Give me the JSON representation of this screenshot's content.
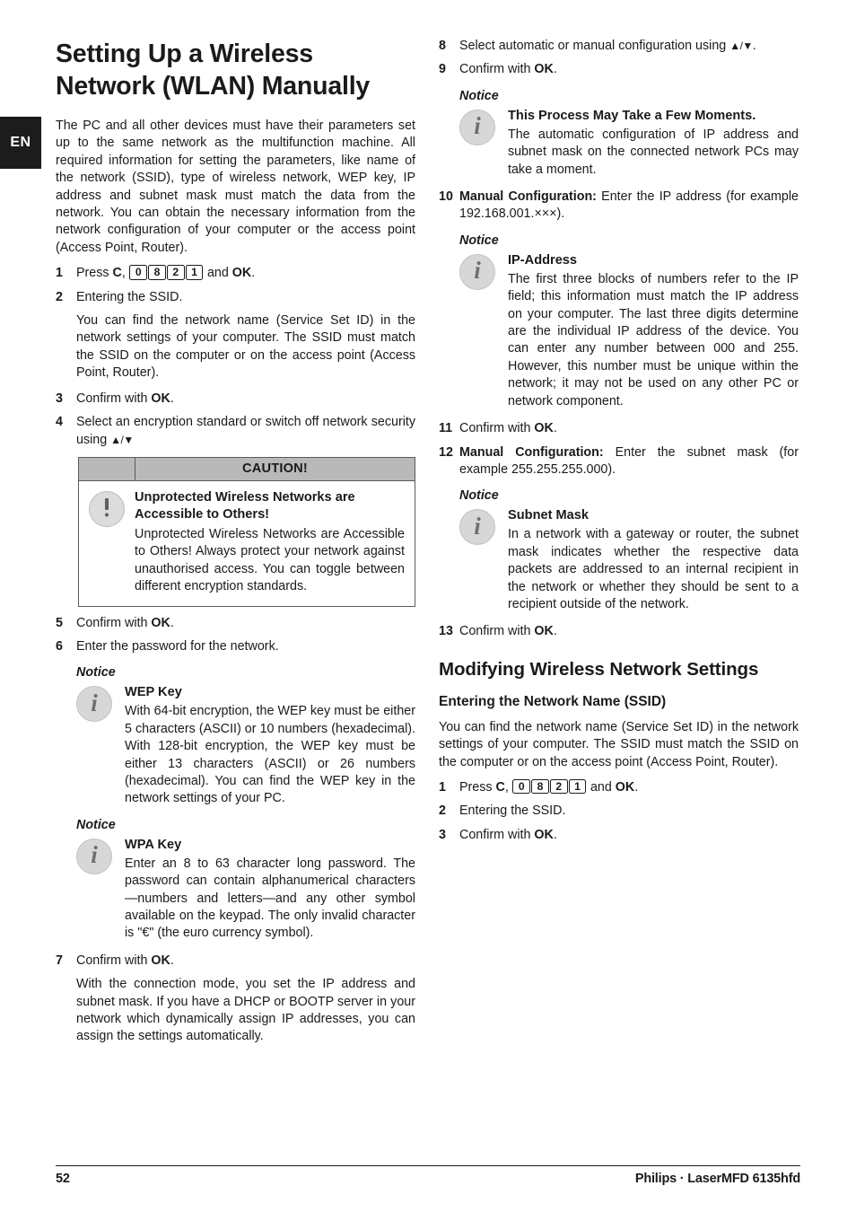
{
  "language_tab": "EN",
  "left_column": {
    "title": "Setting Up a Wireless Network (WLAN) Manually",
    "intro": "The PC and all other devices must have their parameters set up to the same network as the multifunction machine. All required information for setting the parameters, like name of the network (SSID), type of wireless network, WEP key, IP address and subnet mask must match the data from the network. You can obtain the necessary information from the network configuration of your computer or the access point (Access Point, Router).",
    "step1": {
      "num": "1",
      "press_word": "Press",
      "key_c": "C",
      "comma": ",",
      "keys": [
        "0",
        "8",
        "2",
        "1"
      ],
      "and_word": "and",
      "key_ok": "OK",
      "period": "."
    },
    "step2": {
      "num": "2",
      "text": "Entering the SSID."
    },
    "step2_cont": "You can find the network name (Service Set ID) in the network settings of your computer. The SSID must match the SSID on the computer or on the access point (Access Point, Router).",
    "step3": {
      "num": "3",
      "prefix": "Confirm with ",
      "key_ok": "OK",
      "suffix": "."
    },
    "step4": {
      "num": "4",
      "text": "Select an encryption standard or switch off network security using ",
      "arrows": "▲/▼"
    },
    "caution": {
      "header": "CAUTION!",
      "icon": "exclamation-icon",
      "heading": "Unprotected Wireless Networks are Accessible to Others!",
      "text": "Unprotected Wireless Networks are Accessible to Others! Always protect your network against unauthorised access. You can toggle between different encryption standards."
    },
    "step5": {
      "num": "5",
      "prefix": "Confirm with ",
      "key_ok": "OK",
      "suffix": "."
    },
    "step6": {
      "num": "6",
      "text": "Enter the password for the network."
    },
    "notice_wep": {
      "label": "Notice",
      "icon": "info-icon",
      "heading": "WEP Key",
      "text": "With 64-bit encryption, the WEP key must be either 5 characters (ASCII) or 10 numbers (hexadecimal). With 128-bit encryption, the WEP key must be either 13 characters (ASCII) or 26 numbers (hexadecimal). You can find the WEP key in the network settings of your PC."
    },
    "notice_wpa": {
      "label": "Notice",
      "icon": "info-icon",
      "heading": "WPA Key",
      "text": "Enter an 8 to 63 character long password. The password can contain alphanumerical characters—numbers and letters—and any other symbol available on the keypad. The only invalid character is \"€\" (the euro currency symbol)."
    },
    "step7": {
      "num": "7",
      "prefix": "Confirm with ",
      "key_ok": "OK",
      "suffix": "."
    },
    "step7_cont": "With the connection mode, you set the IP address and subnet mask. If you have a DHCP or BOOTP server in your network which dynamically assign IP addresses, you can assign the settings automatically."
  },
  "right_column": {
    "step8": {
      "num": "8",
      "text": "Select automatic or manual configuration using ",
      "arrows": "▲/▼",
      "suffix": "."
    },
    "step9": {
      "num": "9",
      "prefix": "Confirm with ",
      "key_ok": "OK",
      "suffix": "."
    },
    "notice_process": {
      "label": "Notice",
      "icon": "info-icon",
      "heading": "This Process May Take a Few Moments.",
      "text": "The automatic configuration of IP address and subnet mask on the connected network PCs may take a moment."
    },
    "step10": {
      "num": "10",
      "bold_label": "Manual Configuration:",
      "text": " Enter the IP address (for example 192.168.001.×××)."
    },
    "notice_ip": {
      "label": "Notice",
      "icon": "info-icon",
      "heading": "IP-Address",
      "text": "The first three blocks of numbers refer to the IP field; this information must match the IP address on your computer. The last three digits determine are the individual IP address of the device. You can enter any number between 000 and 255. However, this number must be unique within the network; it may not be used on any other PC or network component."
    },
    "step11": {
      "num": "11",
      "prefix": "Confirm with ",
      "key_ok": "OK",
      "suffix": "."
    },
    "step12": {
      "num": "12",
      "bold_label": "Manual Configuration:",
      "text": " Enter the subnet mask (for example 255.255.255.000)."
    },
    "notice_subnet": {
      "label": "Notice",
      "icon": "info-icon",
      "heading": "Subnet Mask",
      "text": "In a network with a gateway or router, the subnet mask indicates whether the respective data packets are addressed to an internal recipient in the network or whether they should be sent to a recipient outside of the network."
    },
    "step13": {
      "num": "13",
      "prefix": "Confirm with ",
      "key_ok": "OK",
      "suffix": "."
    },
    "section_title": "Modifying Wireless Network Settings",
    "subsection_title": "Entering the Network Name (SSID)",
    "subsection_intro": "You can find the network name (Service Set ID) in the network settings of your computer. The SSID must match the SSID on the computer or on the access point (Access Point, Router).",
    "m_step1": {
      "num": "1",
      "press_word": "Press",
      "key_c": "C",
      "comma": ",",
      "keys": [
        "0",
        "8",
        "2",
        "1"
      ],
      "and_word": "and",
      "key_ok": "OK",
      "period": "."
    },
    "m_step2": {
      "num": "2",
      "text": "Entering the SSID."
    },
    "m_step3": {
      "num": "3",
      "prefix": "Confirm with ",
      "key_ok": "OK",
      "suffix": "."
    }
  },
  "footer": {
    "page_number": "52",
    "brand": "Philips · LaserMFD 6135hfd"
  }
}
